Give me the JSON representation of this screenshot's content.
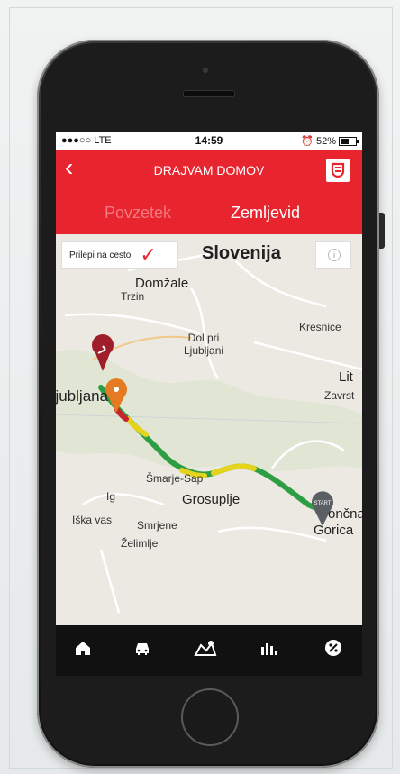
{
  "status": {
    "carrier": "●●●○○ LTE",
    "time": "14:59",
    "battery": "52%"
  },
  "header": {
    "title": "DRAJVAM DOMOV",
    "back_icon": "chevron-left-icon",
    "logo_icon": "app-logo-icon"
  },
  "tabs": [
    {
      "label": "Povzetek",
      "active": false
    },
    {
      "label": "Zemljevid",
      "active": true
    }
  ],
  "map": {
    "snap_label": "Prilepi na cesto",
    "snap_checked": true,
    "labels": {
      "region": "Slovenija",
      "domzale": "Domžale",
      "trzin": "Trzin",
      "kresnice": "Kresnice",
      "dol": "Dol pri\nLjubljani",
      "ljubljana": "Ljubljana",
      "lit": "Lit",
      "zavrst": "Zavrst",
      "smarje": "Šmarje-Sap",
      "grosuplje": "Grosuplje",
      "ig": "Ig",
      "iska": "Iška vas",
      "smrjene": "Smrjene",
      "zelimlje": "Želimlje",
      "goricka_1": "ončna",
      "goricka_2": "Gorica",
      "start_marker": "START"
    },
    "route_colors": {
      "green": "#2e9e44",
      "yellow": "#e6d31c",
      "red": "#e8252f"
    }
  },
  "nav": [
    {
      "icon": "home-icon"
    },
    {
      "icon": "car-icon"
    },
    {
      "icon": "map-pin-icon"
    },
    {
      "icon": "stats-icon"
    },
    {
      "icon": "percent-icon"
    }
  ]
}
